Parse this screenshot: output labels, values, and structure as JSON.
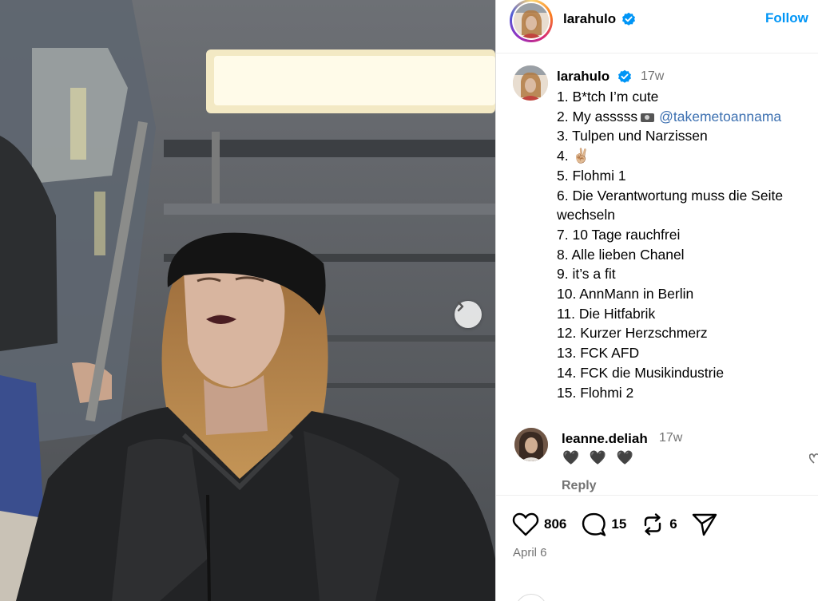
{
  "post": {
    "author": "larahulo",
    "verified": true,
    "follow_label": "Follow",
    "age": "17w",
    "caption_lines": [
      "1. B*tch I’m cute",
      "2. My asssss",
      "@takemetoannama",
      "3. Tulpen und Narzissen",
      "4.",
      "5. Flohmi 1",
      "6. Die Verantwortung muss die Seite wechseln",
      "7. 10 Tage rauchfrei",
      "8. Alle lieben Chanel",
      "9. it’s a fit",
      "10. AnnMann in Berlin",
      "11. Die Hitfabrik",
      "12. Kurzer Herzschmerz",
      "13. FCK AFD",
      "14. FCK die Musikindustrie",
      "15. Flohmi 2"
    ],
    "peace_emoji": "✌🏼",
    "icons": {
      "verified": "verified-badge-icon",
      "camera": "camera-icon",
      "next": "chevron-right-icon"
    }
  },
  "comment": {
    "user": "leanne.deliah",
    "age": "17w",
    "text": "🖤 🖤 🖤",
    "reply_label": "Reply"
  },
  "actions": {
    "likes": "806",
    "comments": "15",
    "reposts": "6",
    "date": "April 6"
  },
  "colors": {
    "accent": "#0095f6",
    "verified": "#0095f6",
    "muted": "#737373",
    "mention": "#3b6fb0"
  }
}
